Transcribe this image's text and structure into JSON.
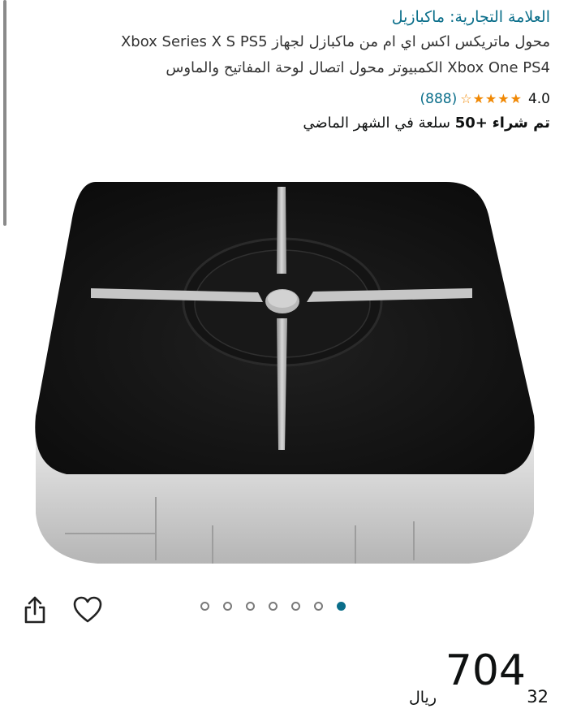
{
  "brand": {
    "label": "العلامة التجارية: ماكبازيل"
  },
  "product": {
    "title_line1": "محول ماتريكس اكس اي ام من ماكبازل لجهاز Xbox Series X S PS5",
    "title_line2": "Xbox One PS4 الكمبيوتر محول اتصال لوحة المفاتيح والماوس"
  },
  "rating": {
    "value": "4.0",
    "stars_filled": 4,
    "stars_total": 5,
    "count": "(888)"
  },
  "sales": {
    "prefix": "تم شراء",
    "amount": "+50",
    "suffix": "سلعة في الشهر الماضي"
  },
  "gallery": {
    "image_count": 7,
    "active_index": 6
  },
  "icons": {
    "share": "share-icon",
    "favorite": "heart-icon"
  },
  "price": {
    "currency": "ريال",
    "whole": "704",
    "fraction": "32"
  },
  "colors": {
    "link": "#0a6e8a",
    "star": "#f08804",
    "active_dot": "#0a6e8a"
  }
}
